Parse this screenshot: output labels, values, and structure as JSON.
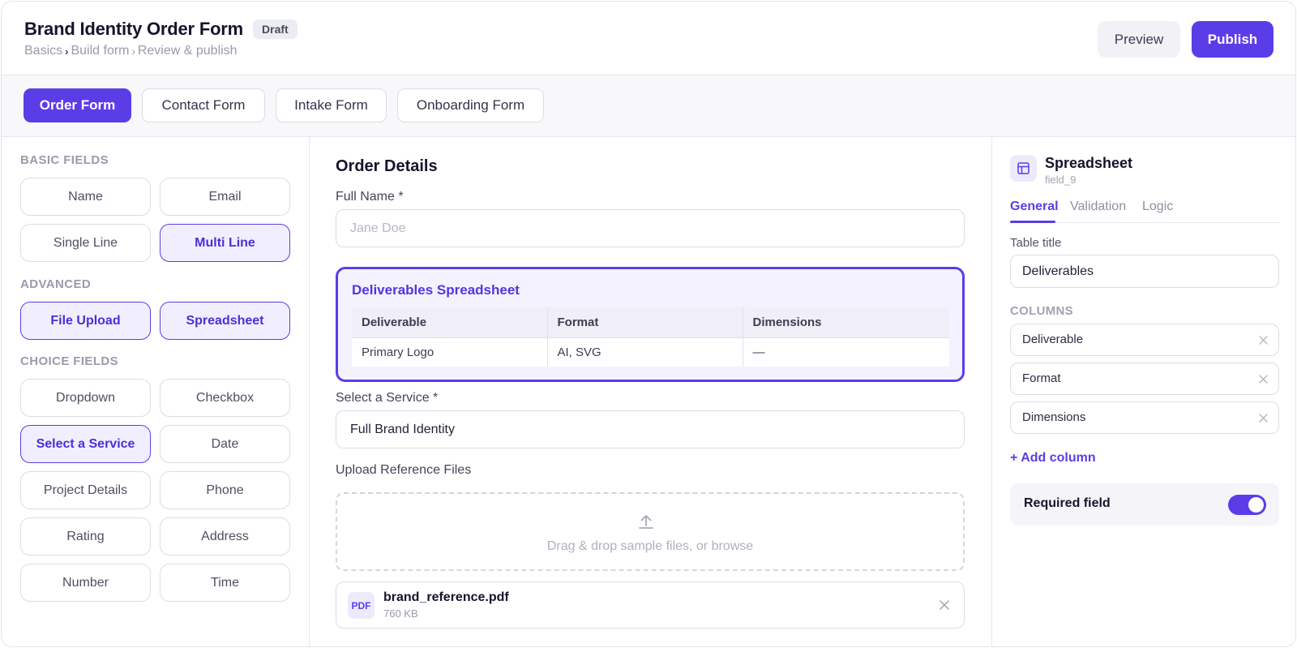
{
  "header": {
    "title": "Brand Identity Order Form",
    "status": "Draft",
    "breadcrumb": [
      "Basics",
      "Build form",
      "Review & publish"
    ],
    "preview_label": "Preview",
    "publish_label": "Publish"
  },
  "form_tabs": [
    "Order Form",
    "Contact Form",
    "Intake Form",
    "Onboarding Form"
  ],
  "palette": {
    "basic_title": "BASIC FIELDS",
    "basic": [
      "Name",
      "Email",
      "Single Line",
      "Multi Line"
    ],
    "advanced_title": "ADVANCED",
    "advanced": [
      "File Upload",
      "Spreadsheet"
    ],
    "choice_title": "CHOICE FIELDS",
    "choice": [
      "Dropdown",
      "Checkbox",
      "Select a Service",
      "Date",
      "Project Details",
      "Phone",
      "Rating",
      "Address",
      "Number",
      "Time"
    ]
  },
  "canvas": {
    "section_title": "Order Details",
    "full_name_label": "Full Name *",
    "full_name_placeholder": "Jane Doe",
    "spreadsheet": {
      "title": "Deliverables Spreadsheet",
      "columns": [
        "Deliverable",
        "Format",
        "Dimensions"
      ],
      "rows": [
        [
          "Primary Logo",
          "AI, SVG",
          "—"
        ]
      ]
    },
    "service_label": "Select a Service *",
    "service_value": "Full Brand Identity",
    "upload_label": "Upload Reference Files",
    "upload_hint": "Drag & drop sample files, or browse",
    "file": {
      "badge": "PDF",
      "name": "brand_reference.pdf",
      "size": "760 KB"
    }
  },
  "properties": {
    "title": "Spreadsheet",
    "field_id": "field_9",
    "tabs": [
      "General",
      "Validation",
      "Logic"
    ],
    "table_title_label": "Table title",
    "table_title_value": "Deliverables",
    "columns_title": "COLUMNS",
    "columns": [
      "Deliverable",
      "Format",
      "Dimensions"
    ],
    "add_column": "+ Add column",
    "required_label": "Required field",
    "required_on": true
  },
  "colors": {
    "accent": "#5b3de8",
    "accent_tint": "#f1efff"
  },
  "icons": [
    "upload-icon",
    "close-icon",
    "table-icon",
    "chevron-right-icon"
  ]
}
